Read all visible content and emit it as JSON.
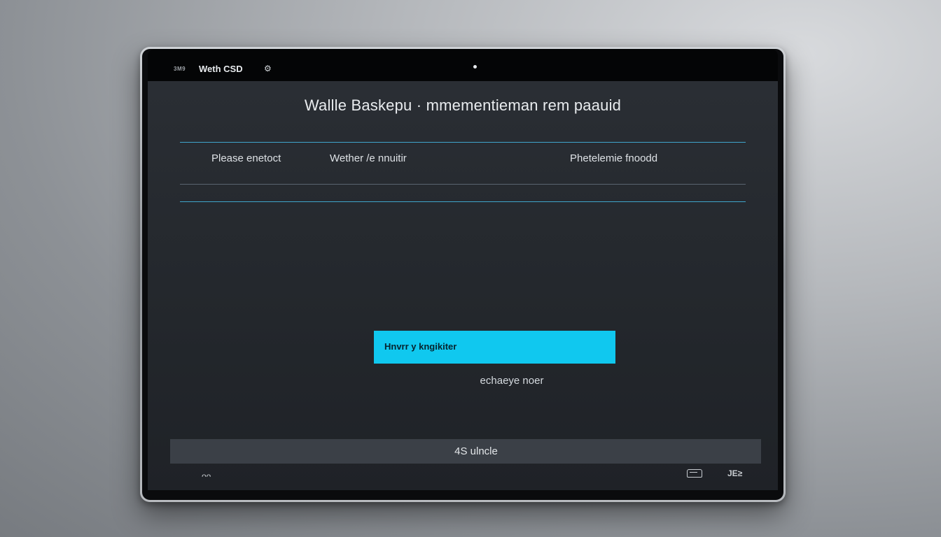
{
  "topbar": {
    "tiny_text": "3M9",
    "device_name": "Weth CSD",
    "icon": "settings-icon"
  },
  "screen": {
    "title": "Wallle Baskepu · mmementieman rem paauid",
    "columns": [
      {
        "label": "Please enetoct"
      },
      {
        "label": "Wether /e nnuitir"
      },
      {
        "label": "Phetelemie fnoodd"
      }
    ],
    "primary_button": "Hnvrr y kngikiter",
    "secondary_link": "echaeye noer",
    "bottom_bar": "4S ulncle",
    "footer": {
      "left_icon": "link-icon",
      "right_icon_a": "car-icon",
      "right_icon_b": "keyboard-icon",
      "left_text": "ᴖᴖ",
      "right_b_text": "JE≥"
    }
  },
  "colors": {
    "accent": "#10c8ef",
    "divider_blue": "#3fa6cc",
    "screen_bg": "#25292e"
  }
}
